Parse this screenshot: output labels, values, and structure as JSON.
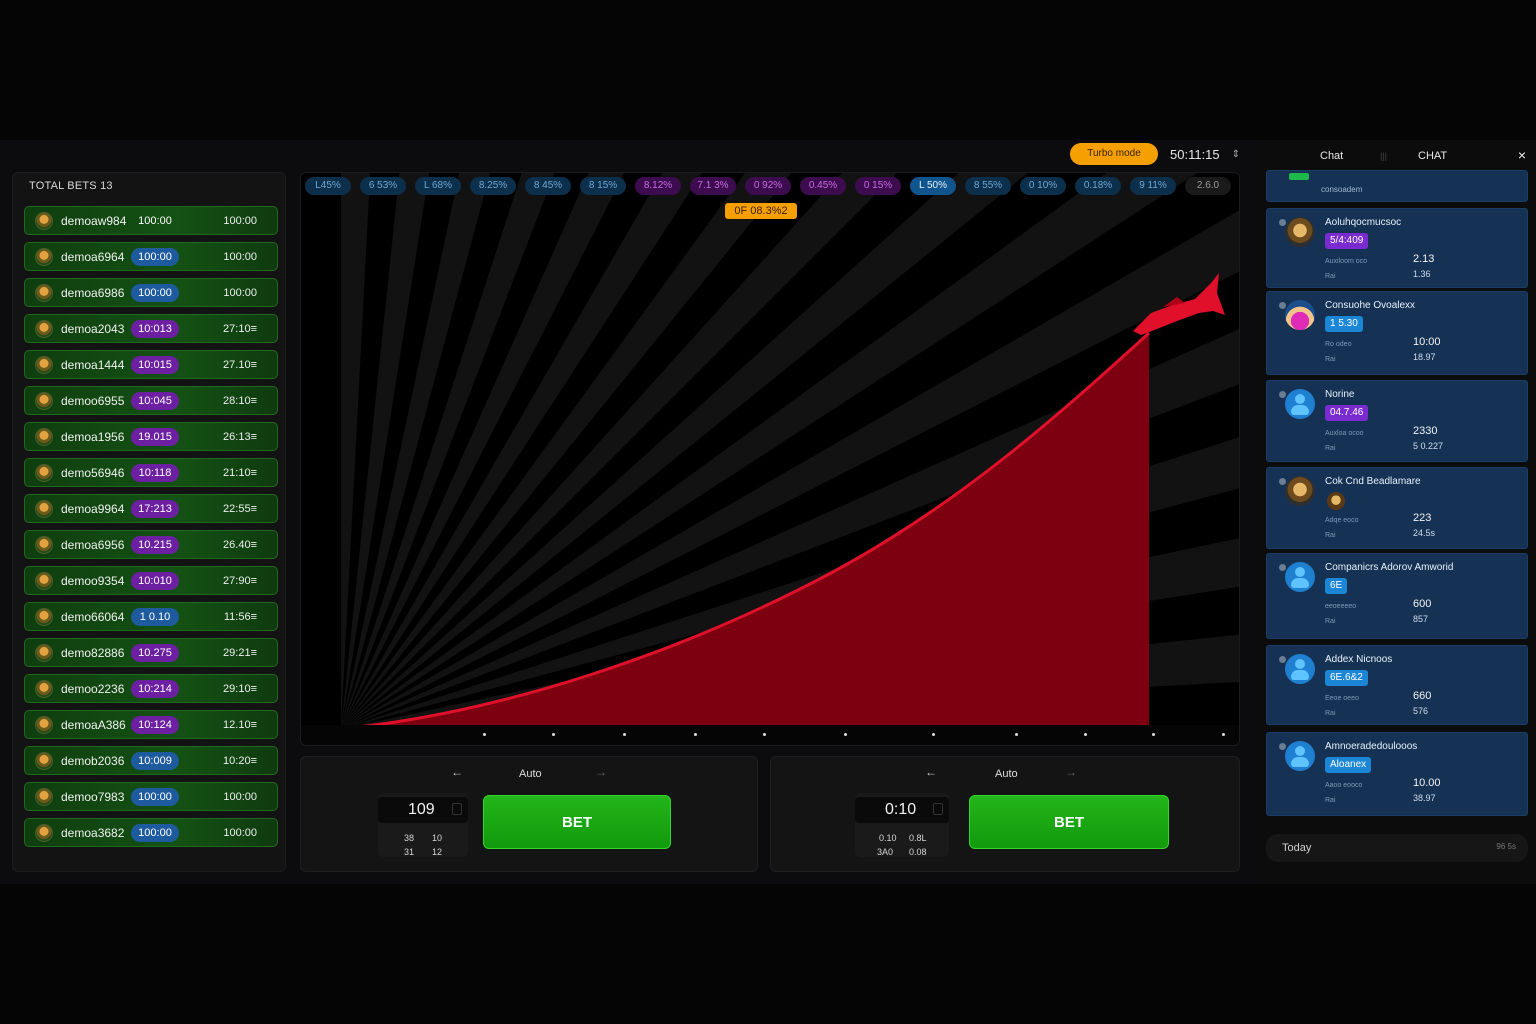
{
  "topbar": {
    "promo_label": "Turbo mode",
    "clock": "50:11:15",
    "updown_icon": "updown-icon"
  },
  "bets": {
    "title": "TOTAL BETS 13",
    "rows": [
      {
        "user": "demoaw984",
        "bet": "100:00",
        "win": "100:00",
        "chip": "green"
      },
      {
        "user": "demoa6964",
        "bet": "100:00",
        "win": "100:00",
        "chip": "blue"
      },
      {
        "user": "demoa6986",
        "bet": "100:00",
        "win": "100:00",
        "chip": "blue"
      },
      {
        "user": "demoa2043",
        "bet": "10:013",
        "win": "27:10≡",
        "chip": "purple"
      },
      {
        "user": "demoa1444",
        "bet": "10:015",
        "win": "27.10≡",
        "chip": "purple"
      },
      {
        "user": "demoo6955",
        "bet": "10:045",
        "win": "28:10≡",
        "chip": "purple"
      },
      {
        "user": "demoa1956",
        "bet": "19.015",
        "win": "26:13≡",
        "chip": "purple"
      },
      {
        "user": "demo56946",
        "bet": "10:118",
        "win": "21:10≡",
        "chip": "purple"
      },
      {
        "user": "demoa9964",
        "bet": "17:213",
        "win": "22:55≡",
        "chip": "purple"
      },
      {
        "user": "demoa6956",
        "bet": "10.215",
        "win": "26.40≡",
        "chip": "purple"
      },
      {
        "user": "demoo9354",
        "bet": "10:010",
        "win": "27:90≡",
        "chip": "purple"
      },
      {
        "user": "demo66064",
        "bet": "1 0.10",
        "win": "11:56≡",
        "chip": "blue"
      },
      {
        "user": "demo82886",
        "bet": "10.275",
        "win": "29:21≡",
        "chip": "purple"
      },
      {
        "user": "demoo2236",
        "bet": "10:214",
        "win": "29:10≡",
        "chip": "purple"
      },
      {
        "user": "demoaA386",
        "bet": "10:124",
        "win": "12.10≡",
        "chip": "purple"
      },
      {
        "user": "demob2036",
        "bet": "10:009",
        "win": "10:20≡",
        "chip": "blue"
      },
      {
        "user": "demoo7983",
        "bet": "100:00",
        "win": "100:00",
        "chip": "blue"
      },
      {
        "user": "demoa3682",
        "bet": "100:00",
        "win": "100:00",
        "chip": "blue"
      }
    ]
  },
  "history": [
    {
      "v": "L45%",
      "c": "b"
    },
    {
      "v": "6 53%",
      "c": "b"
    },
    {
      "v": "L 68%",
      "c": "b"
    },
    {
      "v": "8.25%",
      "c": "b"
    },
    {
      "v": "8 45%",
      "c": "b"
    },
    {
      "v": "8 15%",
      "c": "b"
    },
    {
      "v": "8.12%",
      "c": "p"
    },
    {
      "v": "7.1 3%",
      "c": "p"
    },
    {
      "v": "0 92%",
      "c": "p"
    },
    {
      "v": "0.45%",
      "c": "p"
    },
    {
      "v": "0 15%",
      "c": "p"
    },
    {
      "v": "L 50%",
      "c": "bb"
    },
    {
      "v": "8 55%",
      "c": "b"
    },
    {
      "v": "0 10%",
      "c": "b"
    },
    {
      "v": "0.18%",
      "c": "b"
    },
    {
      "v": "9 11%",
      "c": "b"
    },
    {
      "v": "2.6.0",
      "c": "g"
    }
  ],
  "game": {
    "multiplier_tag": "0F 08.3%2",
    "plane_icon": "plane-icon"
  },
  "panels": [
    {
      "mode": "Auto",
      "amount": "109",
      "q1a": "38",
      "q1b": "10",
      "q2a": "31",
      "q2b": "12",
      "bet_label": "BET"
    },
    {
      "mode": "Auto",
      "amount": "0:10",
      "q1a": "0.10",
      "q1b": "0.8L",
      "q2a": "3A0",
      "q2b": "0.08",
      "bet_label": "BET"
    }
  ],
  "chat": {
    "tab1": "Chat",
    "tab2": "CHAT",
    "sep": "|||",
    "top_snippet": "​consoadem",
    "messages": [
      {
        "name": "Aoluhqocmucsoc",
        "tag": "5/4:409",
        "tagc": "purple",
        "k1": "Auxiloom oco",
        "v1": "2.13",
        "k2": "Rai",
        "v2": "1.36",
        "av": "face"
      },
      {
        "name": "Consuohe Ovoalexx",
        "tag": "1 5.30",
        "tagc": "blue",
        "k1": "Ro odeo",
        "v1": "10:00",
        "k2": "Rai",
        "v2": "18.97",
        "av": "pink"
      },
      {
        "name": "Norine",
        "tag": "04.7.46",
        "tagc": "purple",
        "k1": "Auxloa ocoo",
        "v1": "2330",
        "k2": "Rai",
        "v2": "5 0.227",
        "av": "person"
      },
      {
        "name": "Cok   Cnd Beadlamare",
        "tag": "",
        "tagc": "",
        "k1": "Adqe eoco",
        "v1": "223",
        "k2": "Rai",
        "v2": "24.5s",
        "av": "face"
      },
      {
        "name": "Companicrs   Adorov Amworid",
        "tag": "6E",
        "tagc": "blue",
        "k1": "eeoeeeeo",
        "v1": "600",
        "k2": "Rai",
        "v2": "857",
        "av": "person"
      },
      {
        "name": "Addex Nicnoos",
        "tag": "6E.6&2",
        "tagc": "blue",
        "k1": "Eeoe oeeo",
        "v1": "660",
        "k2": "Rai",
        "v2": "576",
        "av": "person"
      },
      {
        "name": "Amnoeradedoulooos",
        "tag": "Aloanex",
        "tagc": "blue",
        "k1": "Aaoo eooco",
        "v1": "10.00",
        "k2": "Rai",
        "v2": "38.97",
        "av": "person"
      }
    ],
    "today_label": "Today",
    "today_count": "96 5s"
  }
}
